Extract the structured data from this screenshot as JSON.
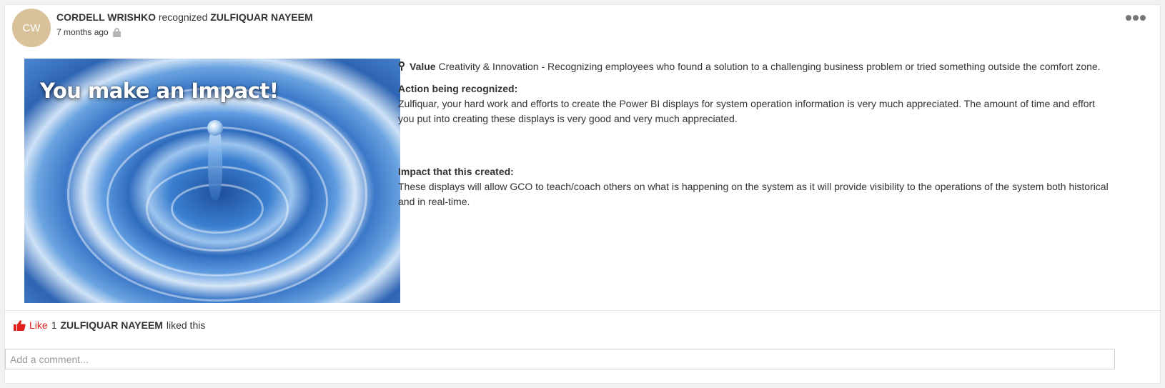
{
  "post": {
    "avatar_initials": "CW",
    "author": "CORDELL WRISHKO",
    "verb": "recognized",
    "recipient": "ZULFIQUAR NAYEEM",
    "timestamp": "7 months ago",
    "privacy_icon": "lock-icon",
    "menu_icon": "more-options-icon"
  },
  "image": {
    "caption": "You make an Impact!"
  },
  "value": {
    "label": "Value",
    "text": "Creativity & Innovation - Recognizing employees who found a solution to a challenging business problem or tried something outside the comfort zone."
  },
  "action": {
    "label": "Action being recognized:",
    "text": "Zulfiquar, your hard work and efforts to create the Power BI displays for system operation information is very much appreciated.  The amount of time and effort you put into creating these displays is very good and very much appreciated."
  },
  "impact": {
    "label": "Impact that this created:",
    "text": "These displays will allow GCO to teach/coach others on what is happening on the system as it will provide visibility to the operations of the system both historical and in real-time."
  },
  "likes": {
    "button_label": "Like",
    "count": "1",
    "liker": "ZULFIQUAR NAYEEM",
    "suffix": "liked this"
  },
  "comment": {
    "placeholder": "Add a comment..."
  },
  "colors": {
    "avatar_bg": "#d9c29a",
    "like_red": "#e0201b"
  }
}
